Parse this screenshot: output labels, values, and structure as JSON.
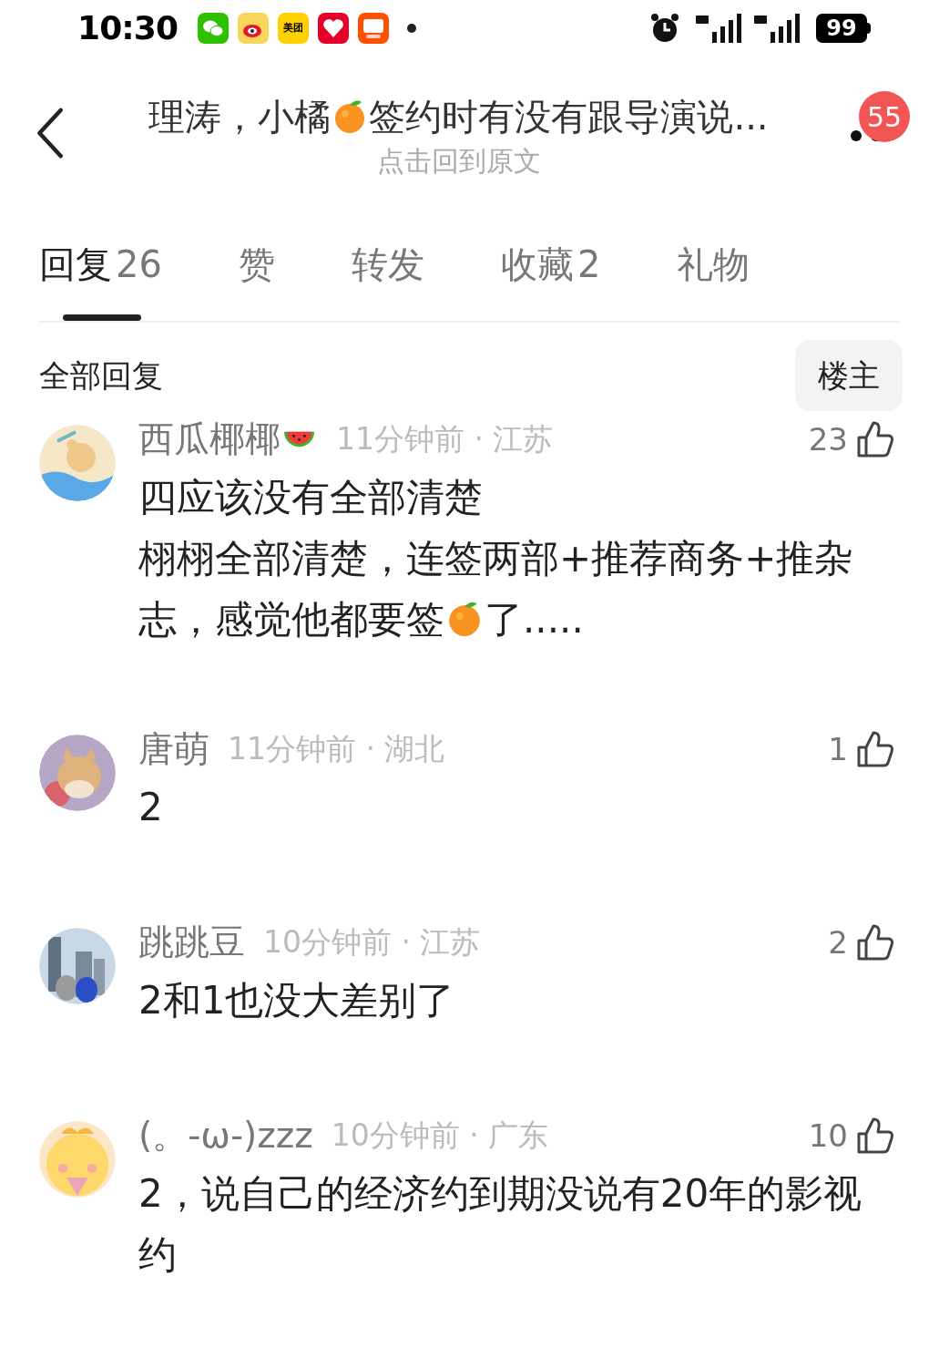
{
  "status_bar": {
    "time": "10:30",
    "apps": [
      {
        "kind": "chat"
      },
      {
        "kind": "weibo"
      },
      {
        "kind": "label",
        "text": "美团"
      },
      {
        "kind": "gift"
      },
      {
        "kind": "taobao"
      }
    ],
    "battery": "99"
  },
  "header": {
    "title": [
      {
        "kind": "text",
        "text": "理涛，小橘"
      },
      {
        "kind": "orange"
      },
      {
        "kind": "text",
        "text": "签约时有没有跟导演说..."
      }
    ],
    "subtitle": "点击回到原文",
    "badge": "55"
  },
  "tabs": [
    {
      "label": "回复",
      "count": "26",
      "selected": true
    },
    {
      "label": "赞",
      "selected": false
    },
    {
      "label": "转发",
      "selected": false
    },
    {
      "label": "收藏",
      "count": "2",
      "selected": false
    },
    {
      "label": "礼物",
      "selected": false
    }
  ],
  "filter": {
    "label": "全部回复",
    "button": "楼主"
  },
  "comments": [
    {
      "name": [
        {
          "kind": "text",
          "text": "西瓜椰椰"
        },
        {
          "kind": "watermelon"
        }
      ],
      "meta": "11分钟前 · 江苏",
      "likes": "23",
      "body": [
        [
          {
            "kind": "text",
            "text": "四应该没有全部清楚"
          }
        ],
        [
          {
            "kind": "text",
            "text": "栩栩全部清楚，连签两部+推荐商务+推杂志，感觉他都要签"
          },
          {
            "kind": "orange"
          },
          {
            "kind": "text",
            "text": "了....."
          }
        ]
      ]
    },
    {
      "name": [
        {
          "kind": "text",
          "text": "唐萌"
        }
      ],
      "meta": "11分钟前 · 湖北",
      "likes": "1",
      "body": [
        [
          {
            "kind": "text",
            "text": "2"
          }
        ]
      ]
    },
    {
      "name": [
        {
          "kind": "text",
          "text": "跳跳豆"
        }
      ],
      "meta": "10分钟前 · 江苏",
      "likes": "2",
      "body": [
        [
          {
            "kind": "text",
            "text": "2和1也没大差别了"
          }
        ]
      ]
    },
    {
      "name": [
        {
          "kind": "text",
          "text": "(。-ω-)zzz"
        }
      ],
      "meta": "10分钟前 · 广东",
      "likes": "10",
      "body": [
        [
          {
            "kind": "text",
            "text": "2，说自己的经济约到期没说有20年的影视约"
          }
        ]
      ]
    }
  ]
}
